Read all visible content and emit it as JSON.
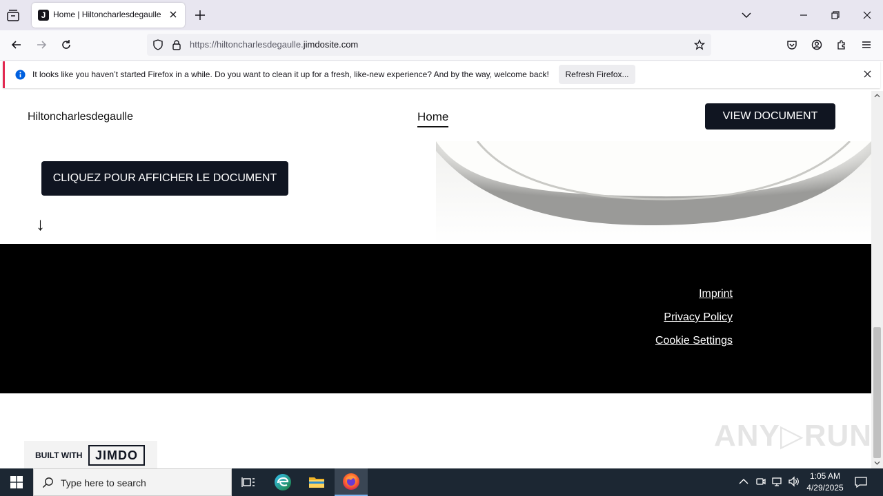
{
  "browser": {
    "tab_title": "Home | Hiltoncharlesdegaulle",
    "favicon_letter": "J",
    "url_prefix": "https://hiltoncharlesdegaulle.",
    "url_domain": "jimdosite.com",
    "notification_text": "It looks like you haven’t started Firefox in a while. Do you want to clean it up for a fresh, like-new experience? And by the way, welcome back!",
    "refresh_button": "Refresh Firefox..."
  },
  "site": {
    "brand": "Hiltoncharlesdegaulle",
    "nav_home": "Home",
    "view_document_button": "VIEW DOCUMENT",
    "cta_button": "CLIQUEZ POUR AFFICHER LE DOCUMENT",
    "arrow": "↓",
    "footer_links": [
      "Imprint",
      "Privacy Policy",
      "Cookie Settings"
    ],
    "badge_built": "BUILT WITH",
    "badge_logo": "JIMDO",
    "watermark": "ANY▷RUN"
  },
  "taskbar": {
    "search_placeholder": "Type here to search",
    "time": "1:05 AM",
    "date": "4/29/2025"
  },
  "colors": {
    "dark_button": "#101521",
    "footer_bg": "#000000",
    "tabstrip_bg": "#e8e6f0",
    "taskbar_bg": "#1c2733",
    "info_blue": "#0060df"
  }
}
